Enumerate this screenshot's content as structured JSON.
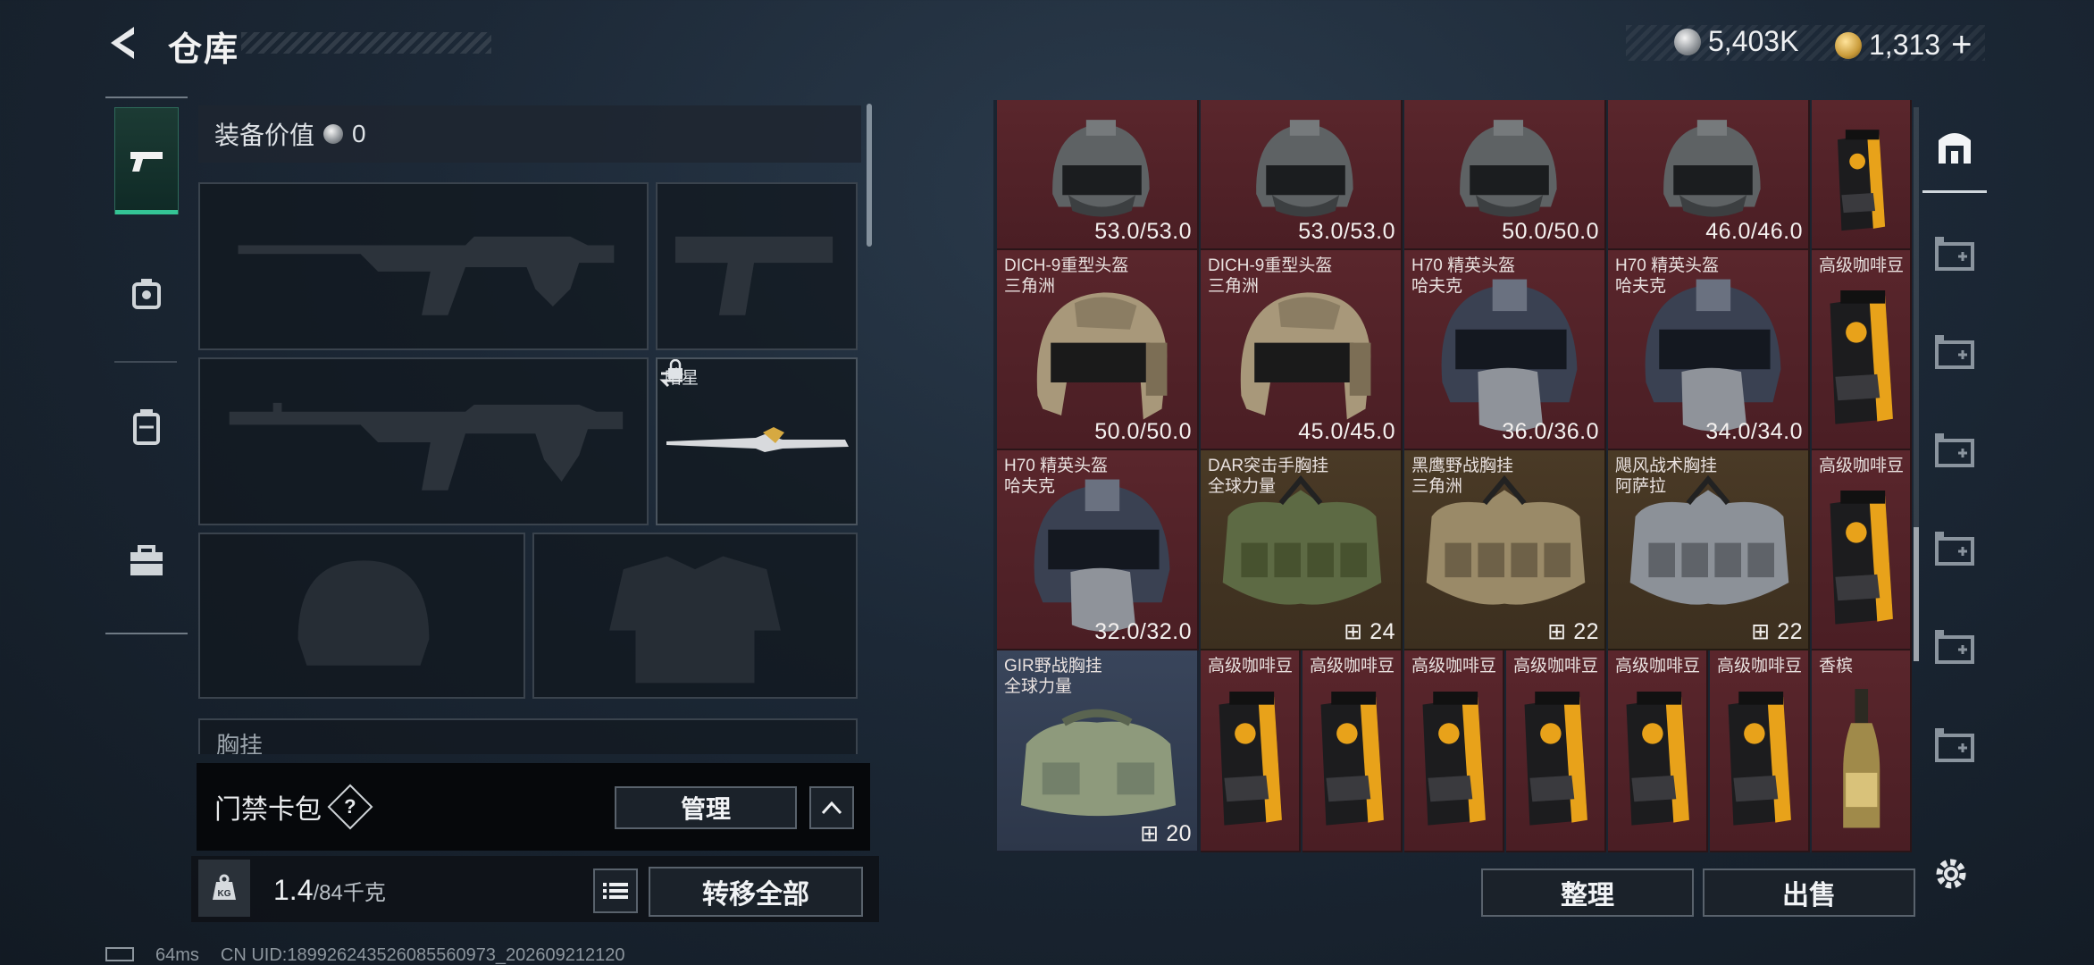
{
  "topbar": {
    "title": "仓库",
    "currency_silver": "5,403K",
    "currency_gold": "1,313"
  },
  "equipment": {
    "header_label": "装备价值",
    "header_value": "0",
    "melee_name": "暗星",
    "chest_peek_label": "胸挂",
    "keycard_label": "门禁卡包",
    "help_label": "?",
    "manage_label": "管理",
    "weight_current": "1.4",
    "weight_max": "/84千克",
    "transfer_all_label": "转移全部",
    "kg_label": "KG"
  },
  "grid": {
    "row1": [
      {
        "value": "53.0/53.0"
      },
      {
        "value": "53.0/53.0"
      },
      {
        "value": "50.0/50.0"
      },
      {
        "value": "46.0/46.0"
      }
    ],
    "row2": [
      {
        "name": "DICH-9重型头盔\n三角洲",
        "value": "50.0/50.0"
      },
      {
        "name": "DICH-9重型头盔\n三角洲",
        "value": "45.0/45.0"
      },
      {
        "name": "H70 精英头盔\n哈夫克",
        "value": "36.0/36.0"
      },
      {
        "name": "H70 精英头盔\n哈夫克",
        "value": "34.0/34.0"
      },
      {
        "name": "高级咖啡豆"
      }
    ],
    "row3": [
      {
        "name": "H70 精英头盔\n哈夫克",
        "value": "32.0/32.0"
      },
      {
        "name": "DAR突击手胸挂\n全球力量",
        "value": "24"
      },
      {
        "name": "黑鹰野战胸挂\n三角洲",
        "value": "22"
      },
      {
        "name": "飓风战术胸挂\n阿萨拉",
        "value": "22"
      },
      {
        "name": "高级咖啡豆"
      }
    ],
    "row4": [
      {
        "name": "GIR野战胸挂\n全球力量",
        "value": "20"
      },
      {
        "name": "高级咖啡豆"
      },
      {
        "name": "高级咖啡豆"
      },
      {
        "name": "高级咖啡豆"
      },
      {
        "name": "高级咖啡豆"
      },
      {
        "name": "高级咖啡豆"
      },
      {
        "name": "高级咖啡豆"
      },
      {
        "name": "香槟"
      }
    ]
  },
  "actions": {
    "sort_label": "整理",
    "sell_label": "出售"
  },
  "status": {
    "ping": "64ms",
    "uid": "CN UID:189926243526085560973_202609212120"
  },
  "colors": {
    "accent": "#34c495",
    "red_cell": "#5a262c",
    "brown_cell": "#4a3a26",
    "blue_cell": "#39455b",
    "coffee_bag": "#e8a21a"
  }
}
